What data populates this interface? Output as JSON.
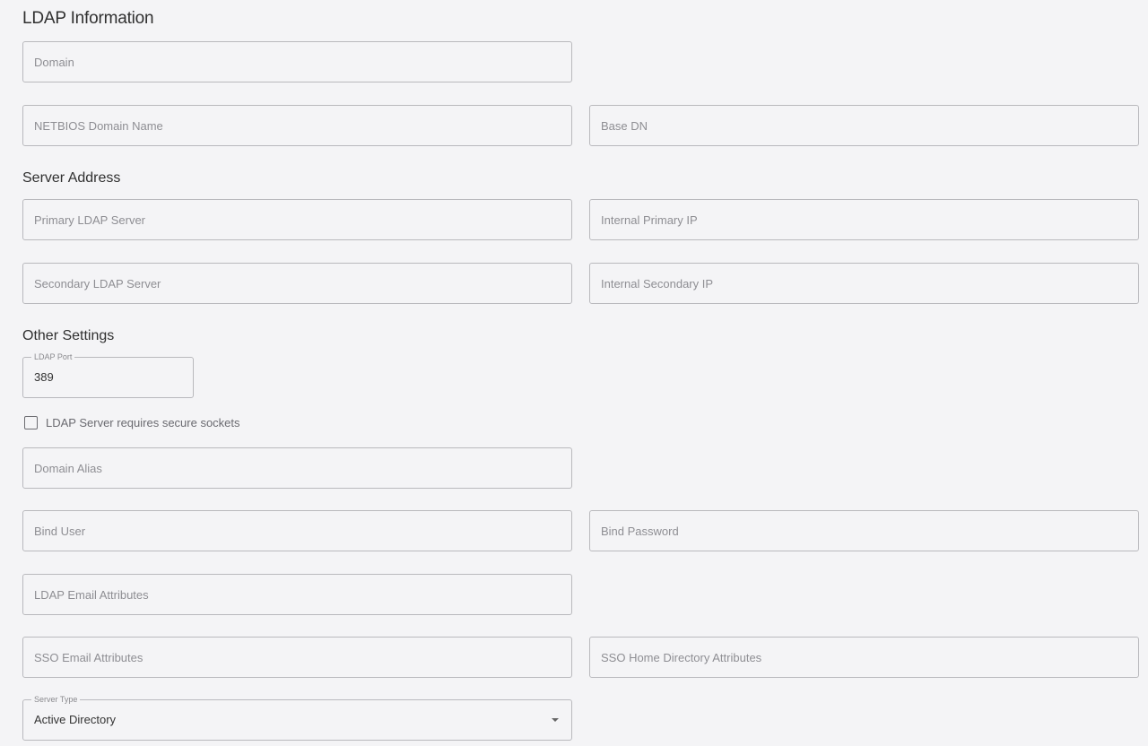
{
  "sections": {
    "ldap_information": "LDAP Information",
    "server_address": "Server Address",
    "other_settings": "Other Settings"
  },
  "fields": {
    "domain": {
      "placeholder": "Domain"
    },
    "netbios_domain_name": {
      "placeholder": "NETBIOS Domain Name"
    },
    "base_dn": {
      "placeholder": "Base DN"
    },
    "primary_ldap_server": {
      "placeholder": "Primary LDAP Server"
    },
    "internal_primary_ip": {
      "placeholder": "Internal Primary IP"
    },
    "secondary_ldap_server": {
      "placeholder": "Secondary LDAP Server"
    },
    "internal_secondary_ip": {
      "placeholder": "Internal Secondary IP"
    },
    "ldap_port": {
      "label": "LDAP Port",
      "value": "389"
    },
    "domain_alias": {
      "placeholder": "Domain Alias"
    },
    "bind_user": {
      "placeholder": "Bind User"
    },
    "bind_password": {
      "placeholder": "Bind Password"
    },
    "ldap_email_attributes": {
      "placeholder": "LDAP Email Attributes"
    },
    "sso_email_attributes": {
      "placeholder": "SSO Email Attributes"
    },
    "sso_home_directory_attributes": {
      "placeholder": "SSO Home Directory Attributes"
    },
    "server_type": {
      "label": "Server Type",
      "value": "Active Directory"
    }
  },
  "secure_sockets": {
    "label": "LDAP Server requires secure sockets",
    "checked": false
  },
  "icons": {
    "dropdown": "caret-down-icon",
    "checkbox": "checkbox-icon"
  }
}
